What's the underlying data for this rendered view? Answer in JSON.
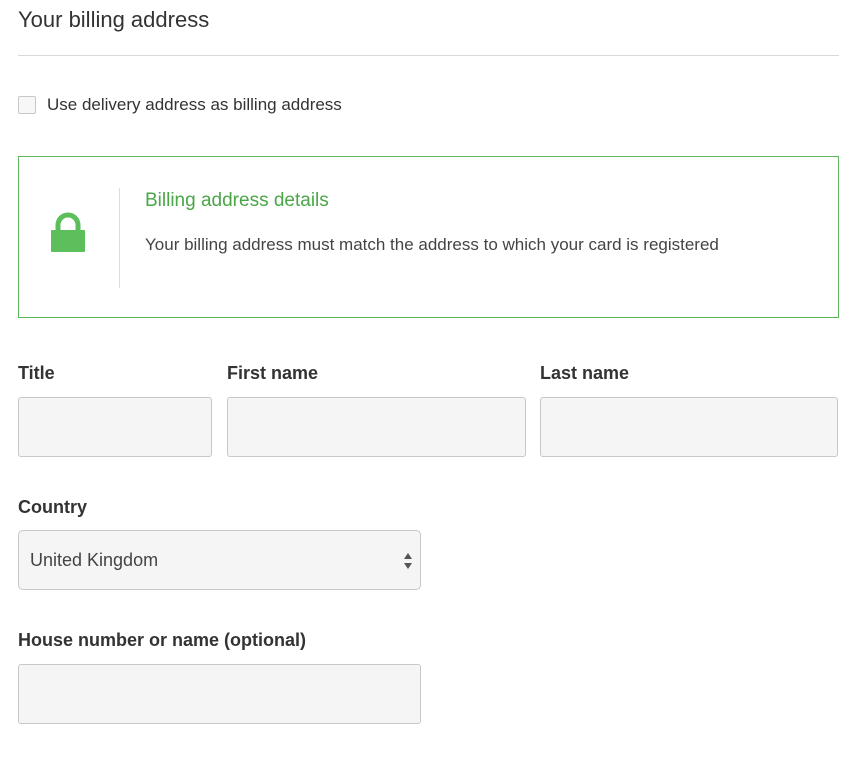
{
  "section": {
    "title": "Your billing address"
  },
  "checkbox": {
    "label": "Use delivery address as billing address",
    "checked": false
  },
  "info_panel": {
    "icon": "lock-icon",
    "heading": "Billing address details",
    "text": "Your billing address must match the address to which your card is registered",
    "accent_color": "#5cb85c"
  },
  "fields": {
    "title": {
      "label": "Title",
      "value": ""
    },
    "first_name": {
      "label": "First name",
      "value": ""
    },
    "last_name": {
      "label": "Last name",
      "value": ""
    },
    "country": {
      "label": "Country",
      "value": "United Kingdom"
    },
    "house": {
      "label": "House number or name (optional)",
      "value": ""
    }
  }
}
